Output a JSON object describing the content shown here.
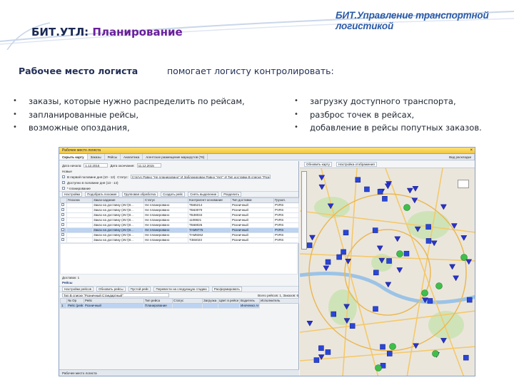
{
  "brand": "БИТ.Управление транспортной логистикой",
  "slide": {
    "title_prefix": "БИТ.УТЛ:",
    "title_accent": "Планирование",
    "lead_left": "Рабочее место логиста",
    "lead_right": "помогает логисту контролировать:",
    "bullets_left": [
      "заказы, которые нужно распределить по рейсам,",
      "запланированные рейсы,",
      "возможные опоздания,"
    ],
    "bullets_right": [
      "загрузку доступного транспорта,",
      "разброс точек в рейсах,",
      "добавление в рейсы попутных заказов."
    ]
  },
  "app": {
    "window_title": "Рабочее место логиста",
    "tabs": [
      "Скрыть карту",
      "Заказы",
      "Рейсы",
      "Аналитика",
      "Агентское размещение маршрутов (76)"
    ],
    "top_right": "Вид раскладки",
    "filters": {
      "date_label": "Дата начала:",
      "date_value": "1.12.2015",
      "end_label": "Дата окончания:",
      "end_value": "11.12.2015",
      "status_label": "Статус:",
      "status_value": "Статус Равно \"Не планировано\" И Заблокирован Равно \"Нет\" И Тип доставки В списке \"Розничный С...",
      "row1_label": "Новые",
      "row2_label": "В первой половине дня (10 - 12)",
      "row3_label": "Доступно в половине дня (13 - 14)",
      "row4_label": "* планирование"
    },
    "orders_toolbar": [
      "Настройки",
      "Подобрать похожие",
      "Групповая обработка",
      "Создать рейс",
      "Снять выделение",
      "Разделить"
    ],
    "orders_columns": [
      "",
      "Геозона",
      "Заказ-задание",
      "Статус",
      "Контрагент-основание",
      "Тип доставки",
      "Грузоп."
    ],
    "orders_rows": [
      [
        "Заказ на доставку (Ист)0...",
        "Не планировано",
        "ТБ65214",
        "Розничный",
        "PVRS"
      ],
      [
        "Заказ на доставку (Ист)0...",
        "Не планировано",
        "ТБ63070",
        "Розничный",
        "PVRS"
      ],
      [
        "Заказ на доставку (Ист)0...",
        "Не планировано",
        "ТБ38034",
        "Розничный",
        "PVRS"
      ],
      [
        "Заказ на доставку (Ист)0...",
        "Не планировано",
        "1108821",
        "Розничный",
        "PVRS"
      ],
      [
        "Заказ на доставку (Ист)0...",
        "Не планировано",
        "ТБ68026",
        "Розничный",
        "PVRS"
      ],
      [
        "Заказ на доставку (Ист)0...",
        "Не планировано",
        "ТАМ8775",
        "Розничный",
        "PVRS"
      ],
      [
        "Заказ на доставку (Ист)0...",
        "Не планировано",
        "ТАМ8262",
        "Розничный",
        "PVRS"
      ],
      [
        "Заказ на доставку (Ист)0...",
        "Не планировано",
        "ТЗ84023",
        "Розничный",
        "PVRS"
      ]
    ],
    "selected_row": 5,
    "delivery_label": "Доставок: 1",
    "trips_section": "Рейсы",
    "trips_toolbar": [
      "Настройки рейсов",
      "Обновить рейсы",
      "Пустой рейс",
      "Перевести на следующую стадию",
      "Расформировать"
    ],
    "trips_filter": "Тип В списке \"Розничный Стандартный\"",
    "trips_right": "Всего рейсов: 1, Заказов: 6",
    "trips_columns": [
      "",
      "№ Ор",
      "Рейс",
      "Тип рейса",
      "Статус",
      "Загрузка",
      "Цвет в рейсе",
      "Водитель",
      "Исполнитель"
    ],
    "trips_row": [
      "1",
      "Рейс (рейс) 300071444 от ...",
      "Розничный",
      "Планирование",
      "",
      "",
      "",
      "Иноченко Александр"
    ],
    "status_bar": "Рабочее место логиста",
    "map_toolbar": [
      "Обновить карту",
      "Настройка отображения"
    ]
  }
}
